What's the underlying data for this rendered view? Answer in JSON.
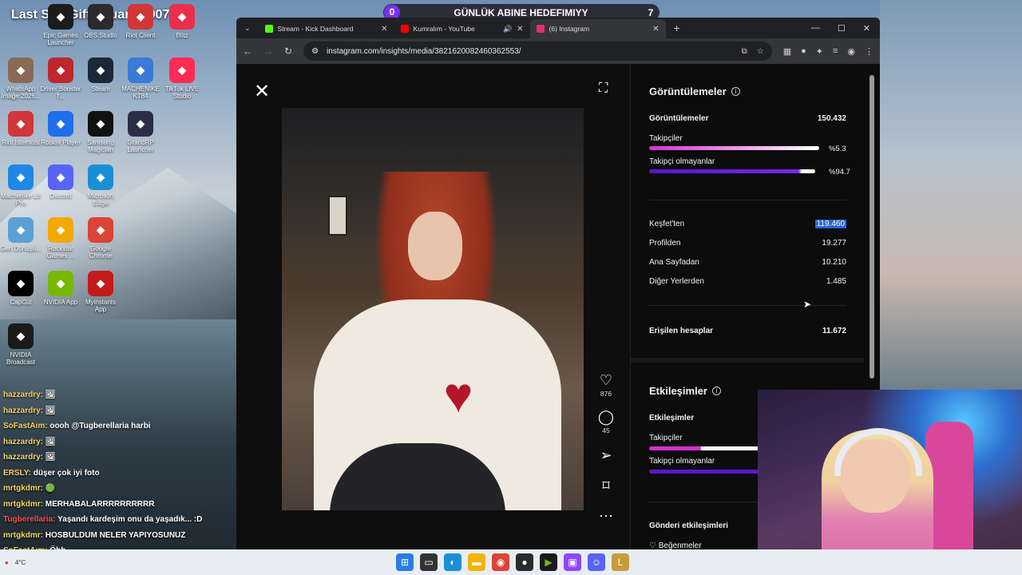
{
  "banner": {
    "text": "Last Sub Gift : guarin1907"
  },
  "goal": {
    "current": "0",
    "title": "GÜNLÜK ABINE HEDEFIMIYY",
    "target": "7"
  },
  "desktop_icons": [
    {
      "label": "Epic Games Launcher",
      "icon": "epic-games-icon",
      "color": "#1c1c1c"
    },
    {
      "label": "OBS Studio",
      "icon": "obs-icon",
      "color": "#2b2b2b"
    },
    {
      "label": "Riot Client",
      "icon": "riot-icon",
      "color": "#d13639"
    },
    {
      "label": "Blitz",
      "icon": "blitz-icon",
      "color": "#e8304a"
    },
    {
      "label": "WhatsApp Image 2026...",
      "icon": "image-thumb-icon",
      "color": "#8a6a55"
    },
    {
      "label": "Driver Booster f...",
      "icon": "driver-booster-icon",
      "color": "#c0272d"
    },
    {
      "label": "Steam",
      "icon": "steam-icon",
      "color": "#1b2838"
    },
    {
      "label": "MACHENIKE KT84",
      "icon": "machenike-icon",
      "color": "#3a7bd5"
    },
    {
      "label": "TikTok LIVE Studio",
      "icon": "tiktok-icon",
      "color": "#fe2c55"
    },
    {
      "label": "Riot İstemcisi",
      "icon": "riot-icon",
      "color": "#d13639"
    },
    {
      "label": "Roblox Player",
      "icon": "roblox-icon",
      "color": "#1f6feb"
    },
    {
      "label": "Samsung Magician",
      "icon": "samsung-magician-icon",
      "color": "#111111"
    },
    {
      "label": "GrandRP Launcher",
      "icon": "grandrp-icon",
      "color": "#2a2f45"
    },
    {
      "label": "Machenike L8 Pro",
      "icon": "machenike-icon",
      "color": "#1e88e5"
    },
    {
      "label": "Discord",
      "icon": "discord-icon",
      "color": "#5865f2"
    },
    {
      "label": "Microsoft Edge",
      "icon": "edge-icon",
      "color": "#1a8fd6"
    },
    {
      "label": "Geri Dönüşü...",
      "icon": "recycle-bin-icon",
      "color": "#5aa0d6"
    },
    {
      "label": "Rockstar Games ...",
      "icon": "rockstar-icon",
      "color": "#f2a900"
    },
    {
      "label": "Google Chrome",
      "icon": "chrome-icon",
      "color": "#db4437"
    },
    {
      "label": "CapCut",
      "icon": "capcut-icon",
      "color": "#000000"
    },
    {
      "label": "NVIDIA App",
      "icon": "nvidia-icon",
      "color": "#76b900"
    },
    {
      "label": "Myinstants App",
      "icon": "myinstants-icon",
      "color": "#c41a1a"
    },
    {
      "label": "NVIDIA Broadcast",
      "icon": "nvidia-broadcast-icon",
      "color": "#1a1a1a"
    }
  ],
  "chat": [
    {
      "user": "hazzardry:",
      "msg": "🖼"
    },
    {
      "user": "hazzardry:",
      "msg": "🖼"
    },
    {
      "user": "SoFastAım:",
      "msg": "oooh @Tugberellaria harbi"
    },
    {
      "user": "hazzardry:",
      "msg": "🖼"
    },
    {
      "user": "hazzardry:",
      "msg": "🖼"
    },
    {
      "user": "ERSLY:",
      "msg": "düşer çok iyi foto"
    },
    {
      "user": "mrtgkdmr:",
      "msg": "🟢"
    },
    {
      "user": "mrtgkdmr:",
      "msg": "MERHABALARRRRRRRRRR"
    },
    {
      "user": "Tugberellaria:",
      "msg": "Yaşandı kardeşim onu da yaşadık... :D"
    },
    {
      "user": "mrtgkdmr:",
      "msg": "HOSBULDUM NELER YAPIYOSUNUZ"
    },
    {
      "user": "SoFastAım:",
      "msg": "Öhh"
    }
  ],
  "browser": {
    "tabs": [
      {
        "title": "Stream - Kick Dashboard",
        "icon": "kick-icon",
        "color": "#53fc18"
      },
      {
        "title": "Kumralım - YouTube",
        "icon": "youtube-icon",
        "color": "#ff0000"
      },
      {
        "title": "(6) Instagram",
        "icon": "instagram-icon",
        "color": "#e1306c"
      }
    ],
    "url": "instagram.com/insights/media/3821620082460362553/"
  },
  "post": {
    "likes": "876",
    "comments": "45"
  },
  "insights": {
    "views_title": "Görüntülemeler",
    "views_label": "Görüntülemeler",
    "views_value": "150.432",
    "followers_label": "Takipçiler",
    "followers_pct": "%5.3",
    "followers_fraction": 0.053,
    "nonfollowers_label": "Takipçi olmayanlar",
    "nonfollowers_pct": "%94.7",
    "nonfollowers_fraction": 0.947,
    "sources": [
      {
        "label": "Keşfet'ten",
        "value": "119.460"
      },
      {
        "label": "Profilden",
        "value": "19.277"
      },
      {
        "label": "Ana Sayfadan",
        "value": "10.210"
      },
      {
        "label": "Diğer Yerlerden",
        "value": "1.485"
      }
    ],
    "reached_label": "Erişilen hesaplar",
    "reached_value": "11.672",
    "interactions_title": "Etkileşimler",
    "interactions_label": "Etkileşimler",
    "int_followers_label": "Takipçiler",
    "int_nonfollowers_label": "Takipçi olmayanlar",
    "post_interactions_label": "Gönderi etkileşimleri",
    "likes_label": "Beğenmeler"
  },
  "taskbar": {
    "weather": "4°C"
  }
}
